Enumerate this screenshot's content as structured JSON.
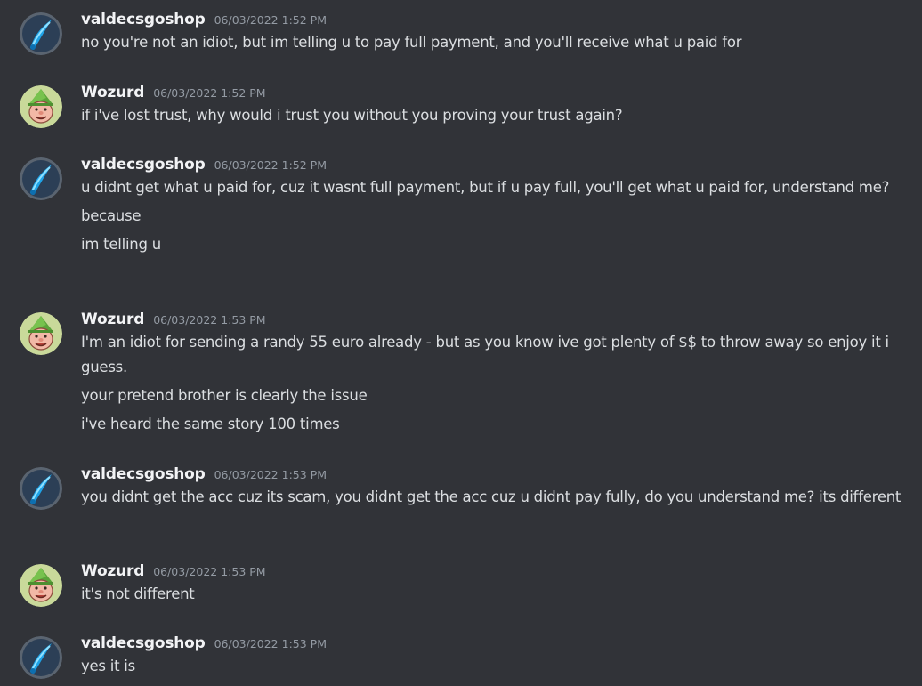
{
  "messages": [
    {
      "author": "valdecsgoshop",
      "avatar": "blue-knife-icon",
      "timestamp": "06/03/2022 1:52 PM",
      "lines": [
        "no you're not an idiot, but im telling u to pay full payment, and you'll receive what u paid for"
      ]
    },
    {
      "author": "Wozurd",
      "avatar": "green-hat-face-icon",
      "timestamp": "06/03/2022 1:52 PM",
      "lines": [
        "if i've lost trust, why would i trust you without you proving your trust again?"
      ]
    },
    {
      "author": "valdecsgoshop",
      "avatar": "blue-knife-icon",
      "timestamp": "06/03/2022 1:52 PM",
      "lines": [
        "u didnt get what u paid for, cuz it wasnt full payment, but if u pay full, you'll get what u paid for, understand me?",
        "because",
        "im telling u"
      ]
    },
    {
      "author": "Wozurd",
      "avatar": "green-hat-face-icon",
      "timestamp": "06/03/2022 1:53 PM",
      "lines": [
        "I'm an idiot for sending a randy 55 euro already - but as you know ive got plenty of $$ to throw away so enjoy it i guess.",
        "your pretend brother is clearly the issue",
        "i've heard the same story 100 times"
      ]
    },
    {
      "author": "valdecsgoshop",
      "avatar": "blue-knife-icon",
      "timestamp": "06/03/2022 1:53 PM",
      "lines": [
        "you didnt get the acc cuz its scam, you didnt get the acc cuz u didnt pay fully, do you understand me? its different"
      ]
    },
    {
      "author": "Wozurd",
      "avatar": "green-hat-face-icon",
      "timestamp": "06/03/2022 1:53 PM",
      "lines": [
        "it's not different"
      ]
    },
    {
      "author": "valdecsgoshop",
      "avatar": "blue-knife-icon",
      "timestamp": "06/03/2022 1:53 PM",
      "lines": [
        "yes it is"
      ]
    }
  ]
}
